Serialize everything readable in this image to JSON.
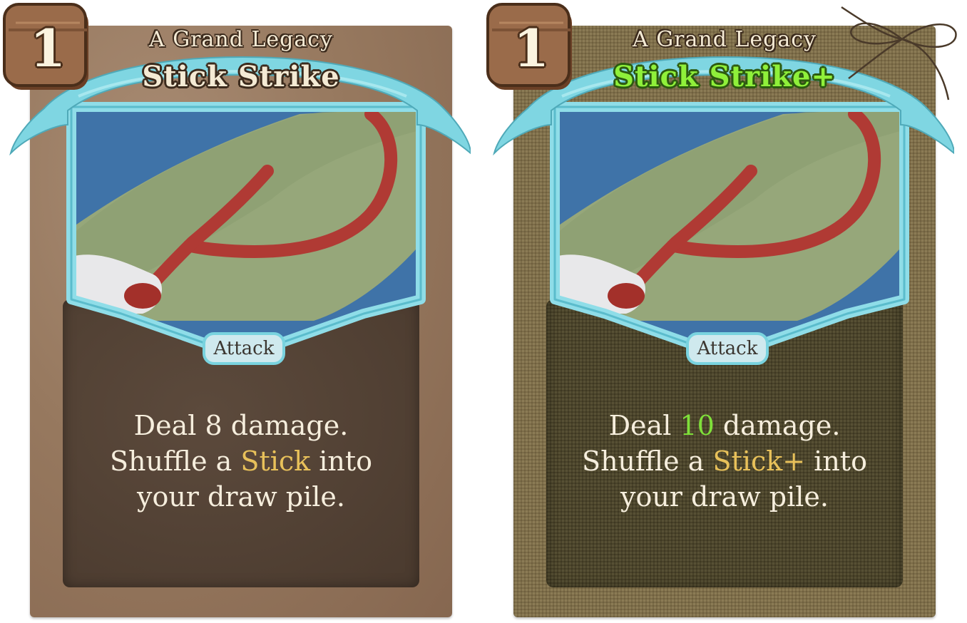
{
  "cards": [
    {
      "id": "base",
      "cost": "1",
      "set_name": "A Grand Legacy",
      "title": "Stick Strike",
      "type": "Attack",
      "description": {
        "line1_pre": "Deal ",
        "damage": "8",
        "line1_post": " damage.",
        "line2_pre": "Shuffle a ",
        "keyword": "Stick",
        "line2_post": " into",
        "line3": "your draw pile."
      }
    },
    {
      "id": "upgraded",
      "cost": "1",
      "set_name": "A Grand Legacy",
      "title": "Stick Strike+",
      "type": "Attack",
      "description": {
        "line1_pre": "Deal ",
        "damage": "10",
        "line1_post": " damage.",
        "line2_pre": "Shuffle a ",
        "keyword": "Stick+",
        "line2_post": " into",
        "line3": "your draw pile."
      }
    }
  ],
  "colors": {
    "banner": "#7fd6e2",
    "frame": "#8fdde8",
    "cost_badge": "#9a6b4a",
    "upgraded_title": "#8ff03a",
    "keyword": "#e8c15a",
    "upgraded_number": "#7fe03a"
  },
  "icons": [
    "cost-badge-icon",
    "twine-bow-icon",
    "stick-art-icon"
  ]
}
